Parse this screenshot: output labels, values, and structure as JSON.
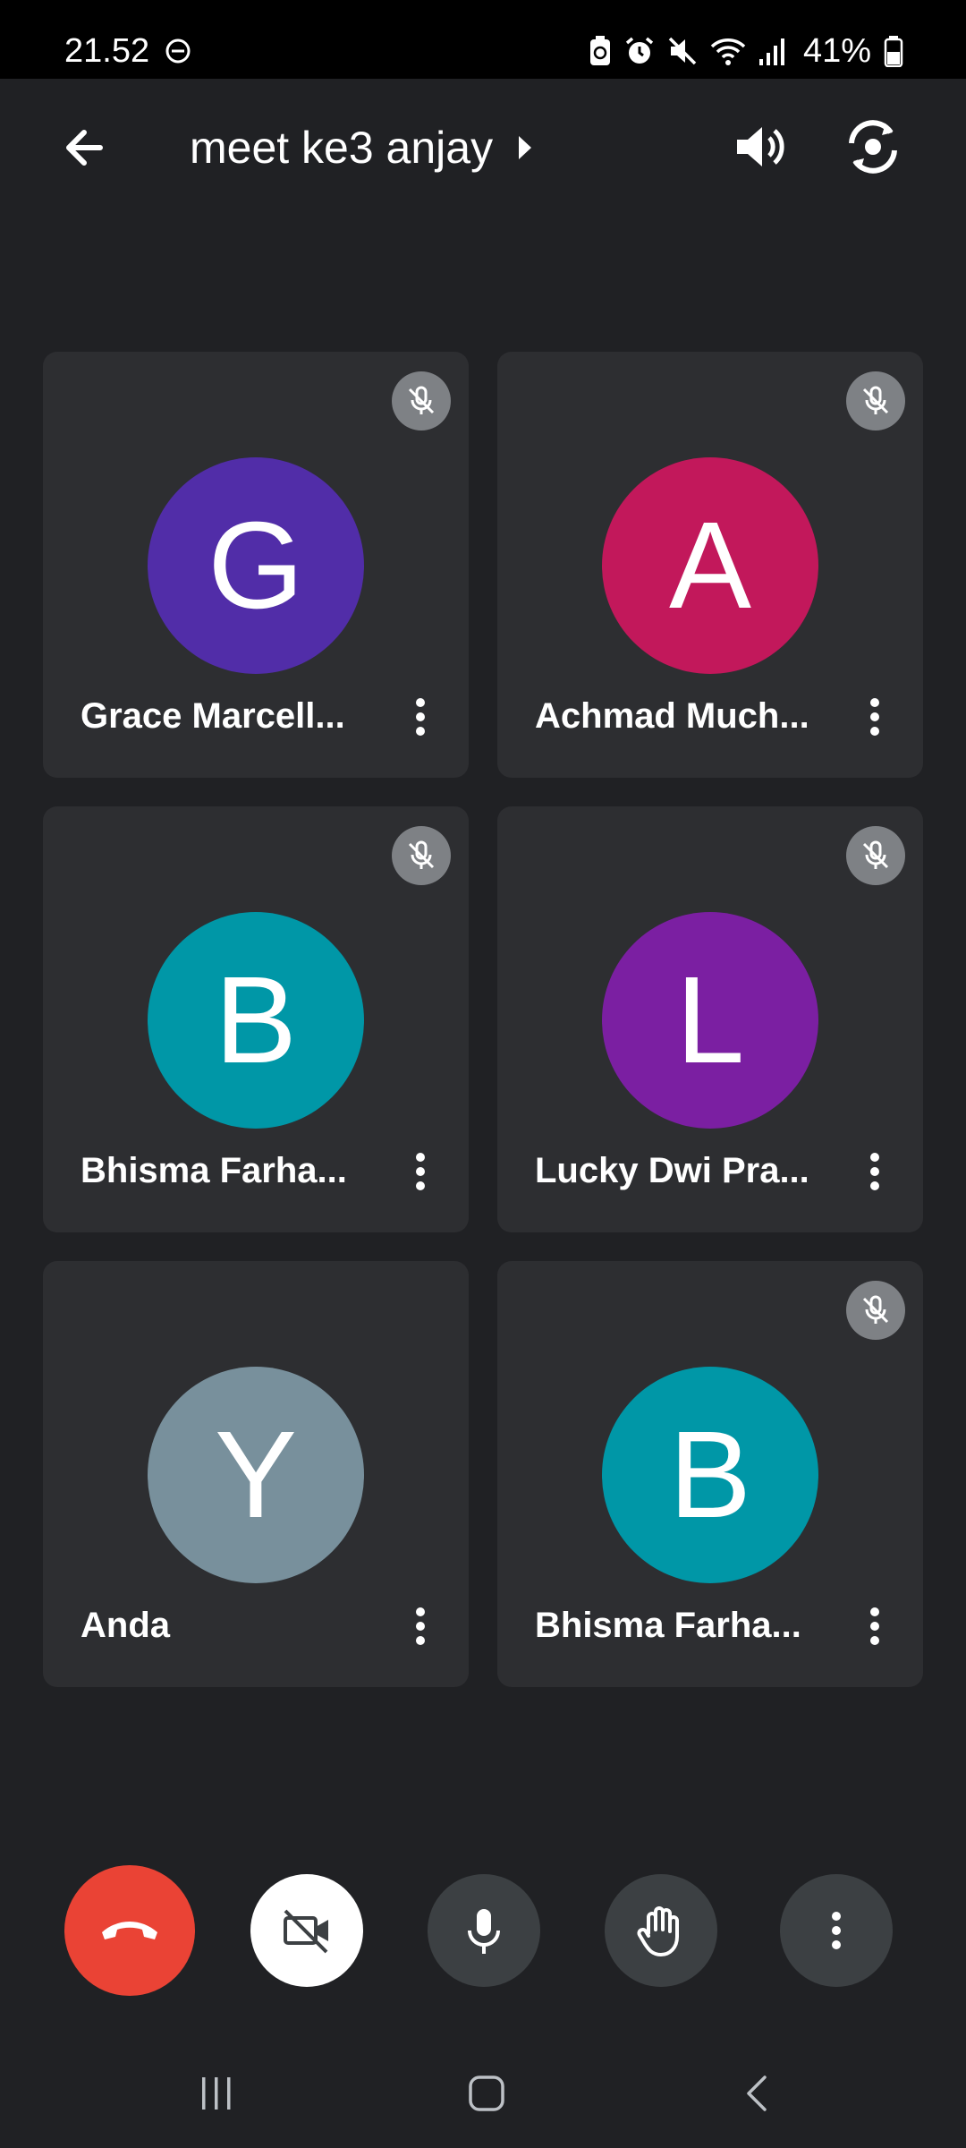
{
  "status_bar": {
    "time": "21.52",
    "battery": "41%",
    "icons": [
      "do-not-disturb-icon",
      "battery-saver-icon",
      "alarm-icon",
      "mute-icon",
      "wifi-icon",
      "signal-icon",
      "battery-icon"
    ]
  },
  "header": {
    "title": "meet ke3 anjay",
    "icons": [
      "back-arrow-icon",
      "chevron-right-icon",
      "speaker-icon",
      "switch-camera-icon"
    ]
  },
  "participants": [
    {
      "initial": "G",
      "name": "Grace Marcell...",
      "color": "#512da8",
      "muted": true
    },
    {
      "initial": "A",
      "name": "Achmad Much...",
      "color": "#c2185b",
      "muted": true
    },
    {
      "initial": "B",
      "name": "Bhisma Farha...",
      "color": "#0097a7",
      "muted": true
    },
    {
      "initial": "L",
      "name": "Lucky Dwi Pra...",
      "color": "#7b1fa2",
      "muted": true
    },
    {
      "initial": "Y",
      "name": "Anda",
      "color": "#78909c",
      "muted": false
    },
    {
      "initial": "B",
      "name": "Bhisma Farha...",
      "color": "#0097a7",
      "muted": true
    }
  ],
  "controls": {
    "icons": [
      "end-call-icon",
      "camera-off-icon",
      "microphone-icon",
      "raise-hand-icon",
      "more-options-icon"
    ],
    "colors": {
      "end_call": "#ea4335",
      "camera_off_bg": "#ffffff",
      "button_bg": "#3c4043"
    }
  },
  "nav_bar": {
    "icons": [
      "recent-apps-icon",
      "home-icon",
      "back-icon"
    ]
  },
  "theme": {
    "background": "#202124",
    "tile": "#2d2e31",
    "mute_badge": "#7e8185"
  }
}
